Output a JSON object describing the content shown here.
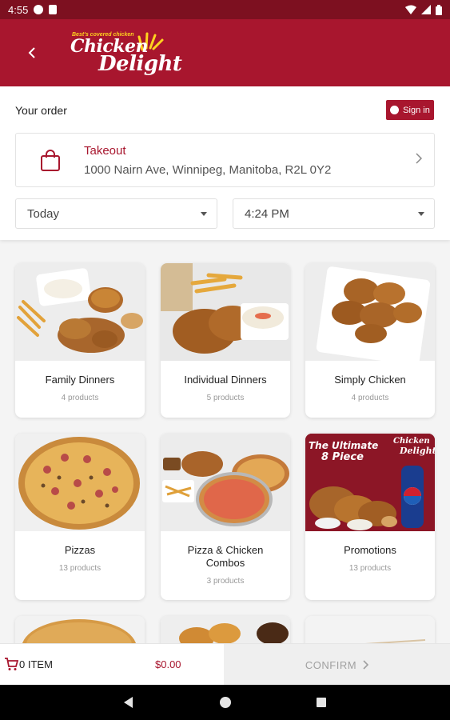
{
  "status_bar": {
    "time": "4:55",
    "icons": [
      "pocket-casts-icon",
      "sd-card-icon",
      "wifi-icon",
      "signal-icon",
      "battery-icon"
    ]
  },
  "header": {
    "back_icon": "chevron-left-icon",
    "logo": {
      "tagline": "Best's covered chicken",
      "word1": "Chicken",
      "word2": "Delight"
    }
  },
  "order": {
    "title": "Your order",
    "sign_in_label": "Sign in",
    "mode_label": "Takeout",
    "address": "1000 Nairn Ave, Winnipeg, Manitoba, R2L 0Y2",
    "day_value": "Today",
    "time_value": "4:24 PM"
  },
  "categories": [
    {
      "name": "Family Dinners",
      "count": "4 products"
    },
    {
      "name": "Individual Dinners",
      "count": "5 products"
    },
    {
      "name": "Simply Chicken",
      "count": "4 products"
    },
    {
      "name": "Pizzas",
      "count": "13 products"
    },
    {
      "name": "Pizza & Chicken Combos",
      "count": "3 products"
    },
    {
      "name": "Promotions",
      "count": "13 products"
    }
  ],
  "promo_image": {
    "headline1": "The Ultimate",
    "headline2": "8 Piece",
    "brand1": "Chicken",
    "brand2": "Delight"
  },
  "cart": {
    "items_label": "0 ITEM",
    "total": "$0.00",
    "confirm_label": "CONFIRM"
  },
  "colors": {
    "brand": "#a8162e",
    "status_bar": "#7d1020",
    "logo_accent": "#ffd21f"
  }
}
